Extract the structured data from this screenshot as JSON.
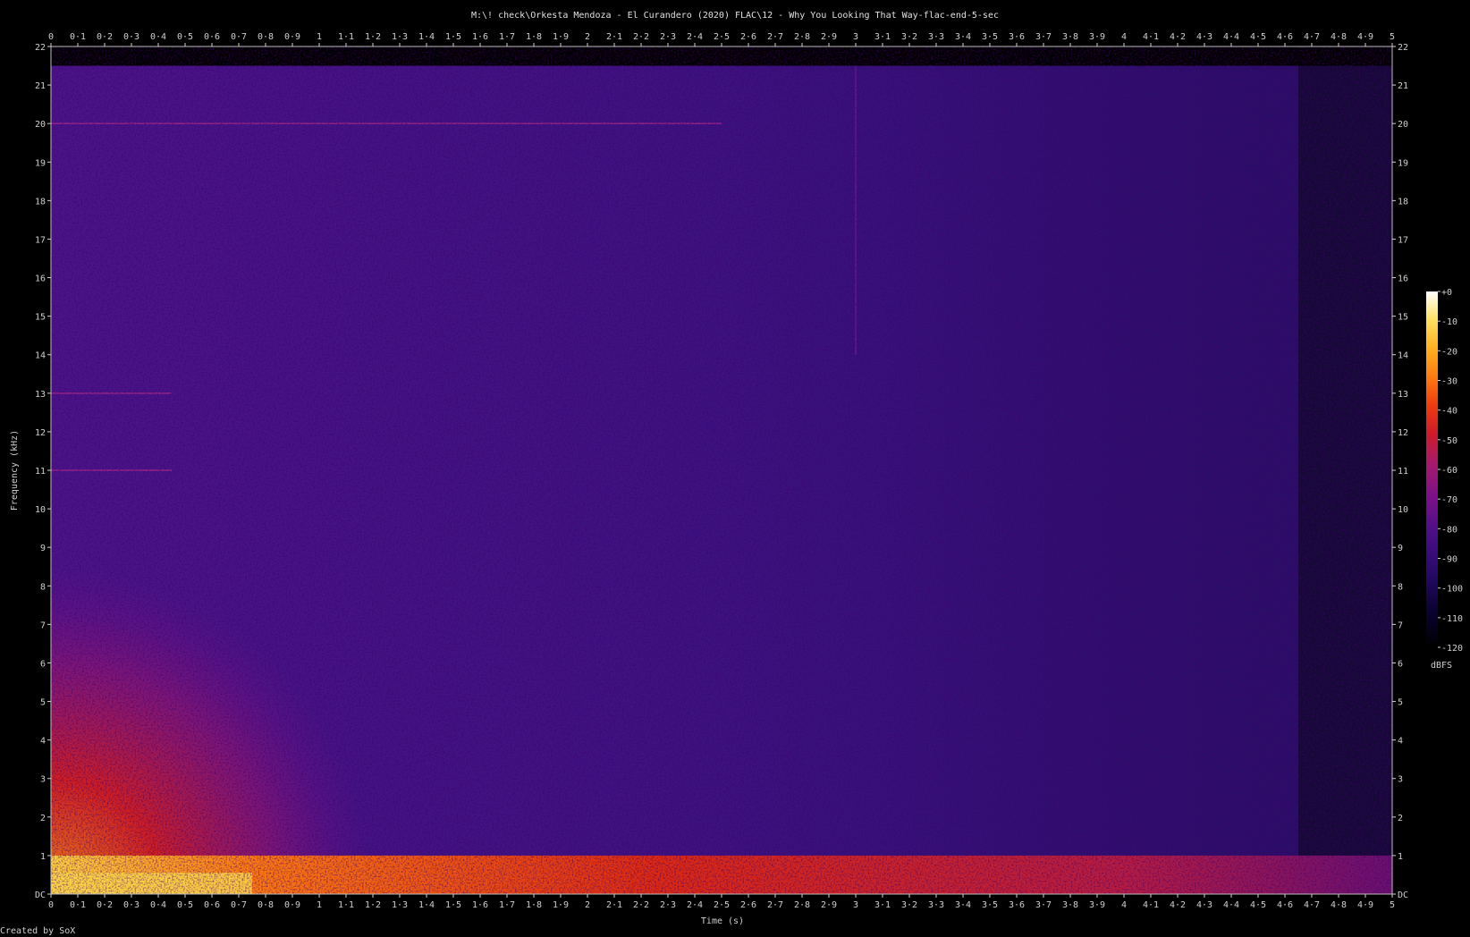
{
  "chart_data": {
    "type": "heatmap",
    "title": "M:\\! check\\Orkesta Mendoza - El Curandero (2020) FLAC\\12 - Why You Looking That Way-flac-end-5-sec",
    "xlabel": "Time (s)",
    "ylabel": "Frequency (kHz)",
    "footer": "Created by SoX",
    "xlim": [
      0,
      5
    ],
    "ylim": [
      0,
      22
    ],
    "x_ticks": [
      "0",
      "0·1",
      "0·2",
      "0·3",
      "0·4",
      "0·5",
      "0·6",
      "0·7",
      "0·8",
      "0·9",
      "1",
      "1·1",
      "1·2",
      "1·3",
      "1·4",
      "1·5",
      "1·6",
      "1·7",
      "1·8",
      "1·9",
      "2",
      "2·1",
      "2·2",
      "2·3",
      "2·4",
      "2·5",
      "2·6",
      "2·7",
      "2·8",
      "2·9",
      "3",
      "3·1",
      "3·2",
      "3·3",
      "3·4",
      "3·5",
      "3·6",
      "3·7",
      "3·8",
      "3·9",
      "4",
      "4·1",
      "4·2",
      "4·3",
      "4·4",
      "4·5",
      "4·6",
      "4·7",
      "4·8",
      "4·9",
      "5"
    ],
    "y_ticks": [
      "DC",
      "1",
      "2",
      "3",
      "4",
      "5",
      "6",
      "7",
      "8",
      "9",
      "10",
      "11",
      "12",
      "13",
      "14",
      "15",
      "16",
      "17",
      "18",
      "19",
      "20",
      "21",
      "22"
    ],
    "colorbar": {
      "label": "dBFS",
      "range": [
        -120,
        0
      ],
      "ticks": [
        "+0",
        "-10",
        "-20",
        "-30",
        "-40",
        "-50",
        "-60",
        "-70",
        "-80",
        "-90",
        "-100",
        "-110",
        "-120"
      ],
      "colors": [
        "#000000",
        "#0a0230",
        "#2a0a6e",
        "#4a0f88",
        "#7a108a",
        "#a81a6a",
        "#d01a2a",
        "#f03a10",
        "#ff7a10",
        "#ffb020",
        "#ffe060",
        "#ffffd0",
        "#ffffff"
      ]
    },
    "features": {
      "energy_cutoff_khz": 21.5,
      "silence_after_s": 4.65,
      "bright_band_khz": [
        0,
        1
      ],
      "hot_region_time_s": [
        0,
        1.2
      ],
      "hot_region_khz": [
        0,
        8.5
      ],
      "tone_lines_khz": [
        20,
        13,
        11
      ],
      "transient_time_s": 3.0
    }
  }
}
